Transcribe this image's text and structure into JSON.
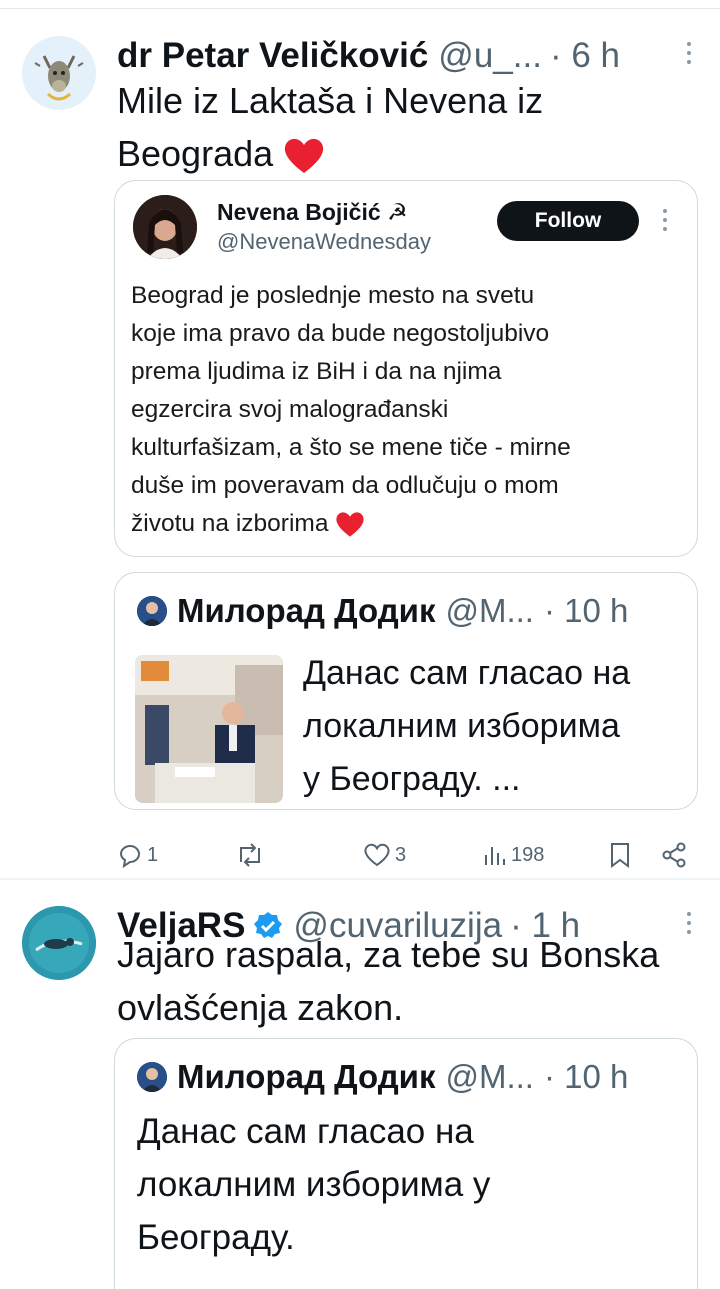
{
  "tweets": [
    {
      "name": "dr Petar Veličković",
      "handle": "@u_...",
      "time": "· 6 h",
      "text_lines": [
        "Mile iz Laktaša i Nevena iz",
        "Beograda"
      ],
      "quote": {
        "name": "Nevena Bojičić ☭",
        "handle": "@NevenaWednesday",
        "follow_label": "Follow",
        "text_lines": [
          "Beograd je poslednje mesto na svetu",
          "koje ima pravo da bude negostoljubivo",
          "prema ljudima iz BiH i da na njima",
          "egzercira svoj malograđanski",
          "kulturfašizam, a što se mene tiče - mirne",
          "duše im poveravam da odlučuju o mom",
          "životu na izborima"
        ]
      },
      "quote2": {
        "name": "Милорад Додик",
        "handle": "@M...",
        "time": "· 10 h",
        "text_lines": [
          "Данас сам гласао на",
          "локалним изборима",
          "у Београду. ..."
        ]
      },
      "actions": {
        "replies": "1",
        "retweets": "",
        "likes": "3",
        "views": "198"
      }
    },
    {
      "name": "VeljaRS",
      "handle": "@cuvariluzija",
      "time": "· 1 h",
      "text_lines": [
        "Jajaro raspala, za tebe su Bonska",
        "ovlašćenja zakon."
      ],
      "quote": {
        "name": "Милорад Додик",
        "handle": "@M...",
        "time": "· 10 h",
        "text_lines": [
          "Данас сам гласао на",
          "локалним изборима у",
          "Београду."
        ]
      }
    }
  ],
  "colors": {
    "accent": "#1d9bf0",
    "heart": "#e8202f",
    "muted": "#536471"
  }
}
